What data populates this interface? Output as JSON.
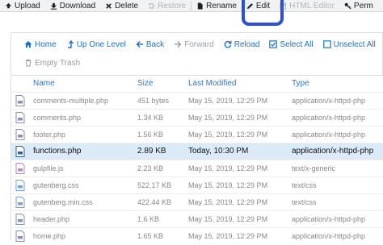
{
  "toolbar": {
    "upload": "Upload",
    "download": "Download",
    "delete": "Delete",
    "restore": "Restore",
    "rename": "Rename",
    "edit": "Edit",
    "html_editor": "HTML Editor",
    "permissions": "Perm"
  },
  "nav": {
    "home": "Home",
    "up_one_level": "Up One Level",
    "back": "Back",
    "forward": "Forward",
    "reload": "Reload",
    "select_all": "Select All",
    "unselect_all": "Unselect All",
    "empty_trash": "Empty Trash"
  },
  "columns": {
    "name": "Name",
    "size": "Size",
    "last_modified": "Last Modified",
    "type": "Type"
  },
  "files": [
    {
      "name": "comments-multiple.php",
      "size": "451 bytes",
      "modified": "May 15, 2019, 12:29 PM",
      "type": "application/x-httpd-php",
      "icon": "php-file-icon"
    },
    {
      "name": "comments.php",
      "size": "1.34 KB",
      "modified": "May 15, 2019, 12:29 PM",
      "type": "application/x-httpd-php",
      "icon": "php-file-icon"
    },
    {
      "name": "footer.php",
      "size": "1.56 KB",
      "modified": "May 15, 2019, 12:29 PM",
      "type": "application/x-httpd-php",
      "icon": "php-file-icon"
    },
    {
      "name": "functions.php",
      "size": "2.89 KB",
      "modified": "Today, 10:30 PM",
      "type": "application/x-httpd-php",
      "icon": "php-file-icon",
      "selected": true
    },
    {
      "name": "gulpfile.js",
      "size": "2.23 KB",
      "modified": "May 15, 2019, 12:29 PM",
      "type": "text/x-generic",
      "icon": "js-file-icon"
    },
    {
      "name": "gutenberg.css",
      "size": "522.17 KB",
      "modified": "May 15, 2019, 12:29 PM",
      "type": "text/css",
      "icon": "css-file-icon"
    },
    {
      "name": "gutenberg.min.css",
      "size": "422.44 KB",
      "modified": "May 15, 2019, 12:29 PM",
      "type": "text/css",
      "icon": "css-file-icon"
    },
    {
      "name": "header.php",
      "size": "1.6 KB",
      "modified": "May 15, 2019, 12:29 PM",
      "type": "application/x-httpd-php",
      "icon": "php-file-icon"
    },
    {
      "name": "home.php",
      "size": "1.65 KB",
      "modified": "May 15, 2019, 12:29 PM",
      "type": "application/x-httpd-php",
      "icon": "php-file-icon"
    }
  ],
  "colors": {
    "accent": "#1a73c8",
    "highlight_ring": "#2b4fd8",
    "selected_row": "#dbeaf7"
  }
}
